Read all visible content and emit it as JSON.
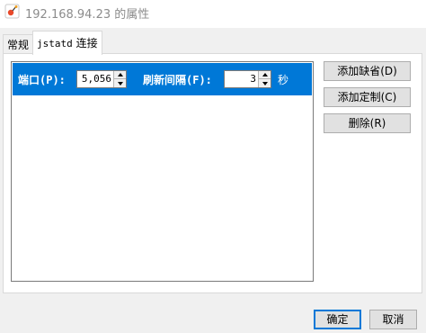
{
  "window": {
    "title": "192.168.94.23 的属性"
  },
  "tabs": [
    {
      "label": "常规",
      "selected": false
    },
    {
      "label_mono": "jstatd",
      "label_rest": " 连接",
      "selected": true
    }
  ],
  "connection": {
    "port_label": "端口(P):",
    "port_value": "5,056",
    "interval_label": "刷新间隔(F):",
    "interval_value": "3",
    "interval_unit": "秒"
  },
  "side_buttons": {
    "add_default": "添加缺省(D)",
    "add_custom": "添加定制(C)",
    "delete": "删除(R)"
  },
  "footer": {
    "ok": "确定",
    "cancel": "取消"
  },
  "colors": {
    "selection": "#0078d7",
    "app_icon": "#e8492a"
  }
}
